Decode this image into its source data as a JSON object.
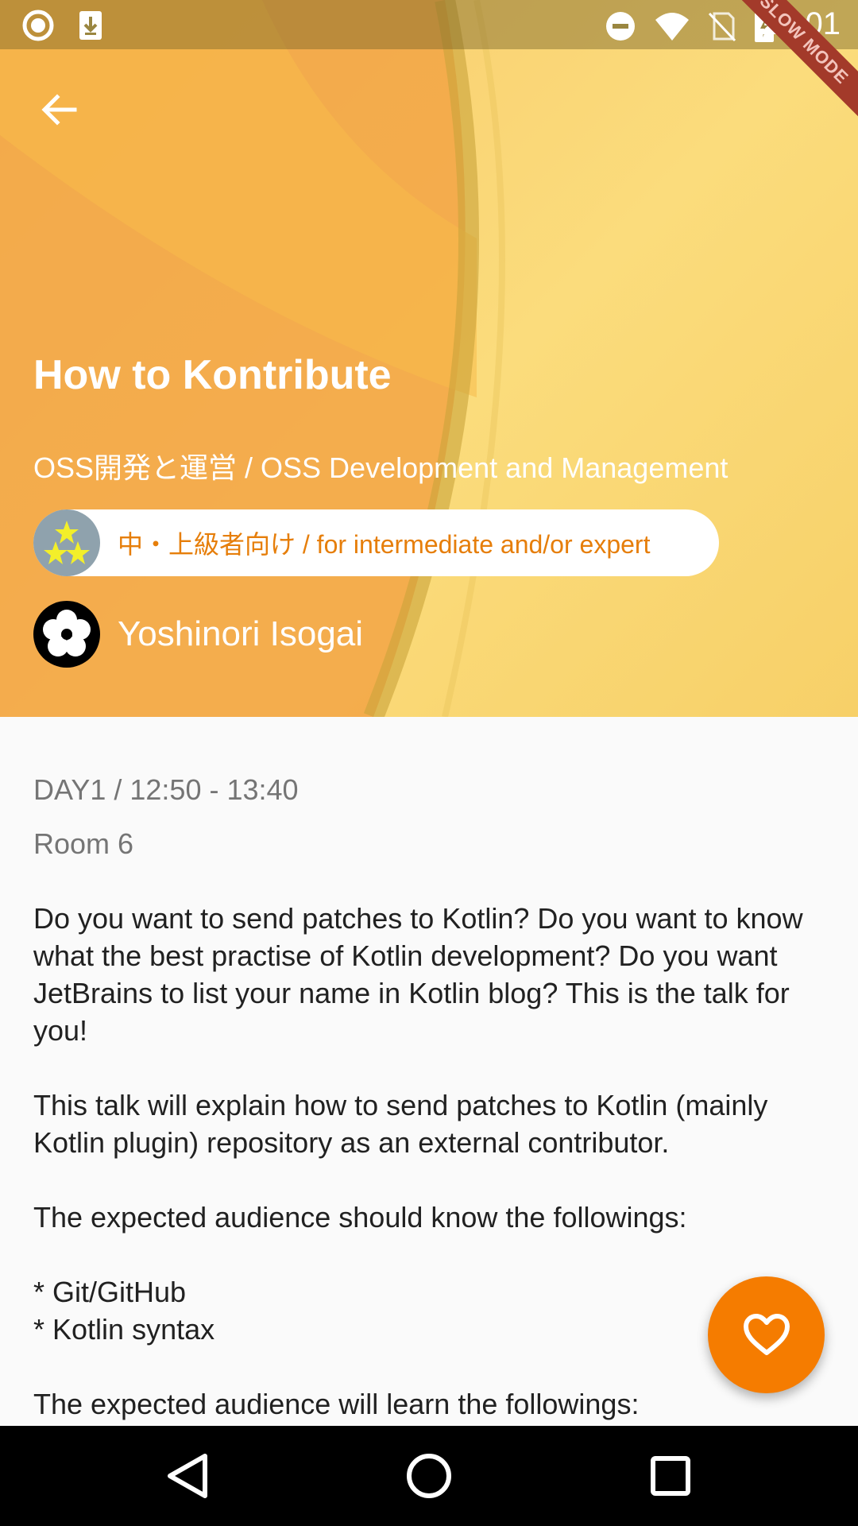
{
  "status_bar": {
    "time": "23:01",
    "left_icons": [
      "record-icon",
      "download-icon"
    ],
    "right_icons": [
      "do-not-disturb-icon",
      "wifi-icon",
      "no-sim-icon",
      "battery-charging-icon"
    ]
  },
  "debug_banner": "SLOW MODE",
  "session": {
    "title": "How to Kontribute",
    "category": "OSS開発と運営 / OSS Development and Management",
    "level": "中・上級者向け / for intermediate and/or expert",
    "speaker": "Yoshinori Isogai",
    "time": "DAY1 / 12:50 - 13:40",
    "room": "Room 6",
    "description": "Do you want to send patches to Kotlin? Do you want to know what the best practise of Kotlin development? Do you want JetBrains to list your name in Kotlin blog? This is the talk for you!\n\nThis talk will explain how to send patches to Kotlin (mainly Kotlin plugin) repository as an external contributor.\n\nThe expected audience should know the followings:\n\n* Git/GitHub\n* Kotlin syntax\n\nThe expected audience will learn the followings:"
  },
  "icons": {
    "back": "arrow-back-icon",
    "level": "star-icon",
    "speaker": "flower-crest-icon",
    "fab": "heart-outline-icon"
  },
  "colors": {
    "accent": "#f57c00",
    "level_text": "#e67e0a",
    "header_light": "#fbdc7c",
    "header_dark": "#f2a445"
  }
}
